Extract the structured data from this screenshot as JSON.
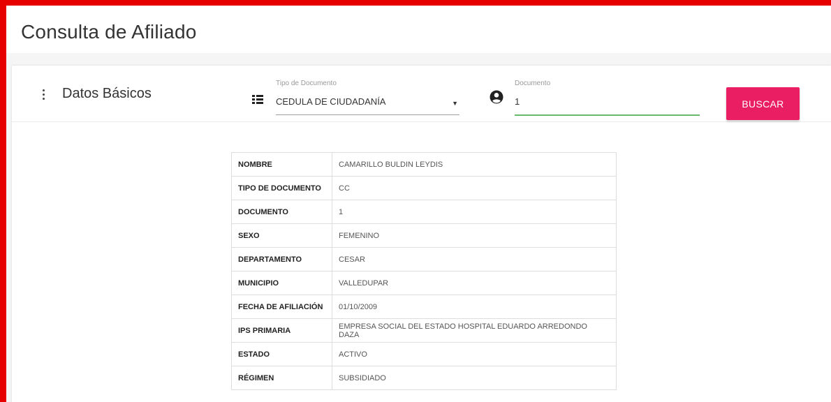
{
  "page": {
    "title": "Consulta de Afiliado"
  },
  "section": {
    "title": "Datos Básicos"
  },
  "form": {
    "tipo_documento": {
      "label": "Tipo de Documento",
      "value": "CEDULA DE CIUDADANÍA"
    },
    "documento": {
      "label": "Documento",
      "value": "1"
    },
    "buscar_label": "BUSCAR"
  },
  "colors": {
    "accent": "#e91e63",
    "input_focus": "#66bb6a",
    "frame": "#e60000"
  },
  "icons": {
    "menu": "more-vertical-icon",
    "list": "list-icon",
    "user": "account-circle-icon"
  },
  "affiliate": {
    "rows": [
      {
        "key": "NOMBRE",
        "value": "CAMARILLO BULDIN LEYDIS"
      },
      {
        "key": "TIPO DE DOCUMENTO",
        "value": "CC"
      },
      {
        "key": "DOCUMENTO",
        "value": "1"
      },
      {
        "key": "SEXO",
        "value": "FEMENINO"
      },
      {
        "key": "DEPARTAMENTO",
        "value": "CESAR"
      },
      {
        "key": "MUNICIPIO",
        "value": "VALLEDUPAR"
      },
      {
        "key": "FECHA DE AFILIACIÓN",
        "value": "01/10/2009"
      },
      {
        "key": "IPS PRIMARIA",
        "value": "EMPRESA SOCIAL DEL ESTADO HOSPITAL EDUARDO ARREDONDO DAZA"
      },
      {
        "key": "ESTADO",
        "value": "ACTIVO"
      },
      {
        "key": "RÉGIMEN",
        "value": "SUBSIDIADO"
      }
    ]
  }
}
